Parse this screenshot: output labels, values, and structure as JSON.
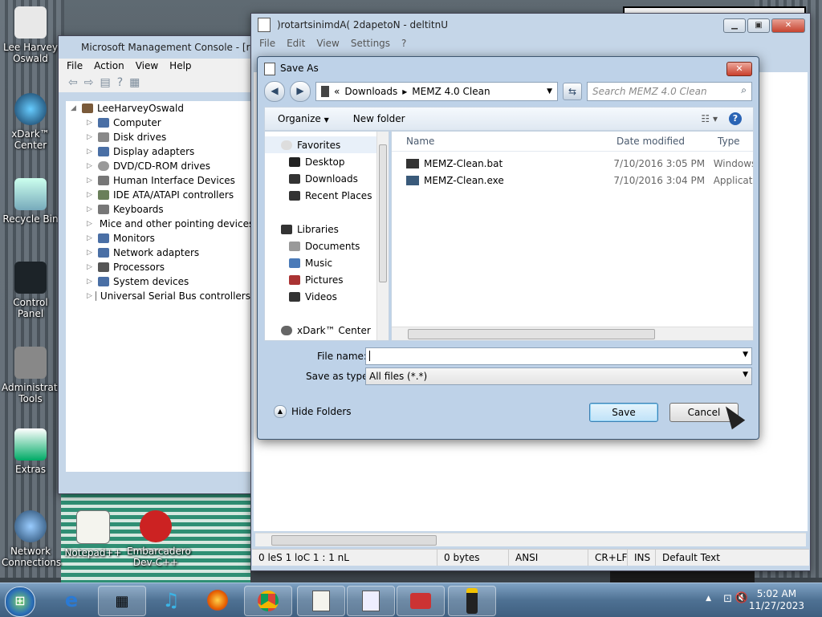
{
  "desktop": {
    "icons": [
      {
        "label": "Lee Harvey Oswald",
        "icon": "user-folder-icon"
      },
      {
        "label": "xDark™ Center",
        "icon": "xdark-center-icon"
      },
      {
        "label": "Recycle Bin",
        "icon": "recycle-bin-icon"
      },
      {
        "label": "Control Panel",
        "icon": "control-panel-icon"
      },
      {
        "label": "Administrat... Tools",
        "icon": "admin-tools-icon"
      },
      {
        "label": "Extras",
        "icon": "extras-icon"
      },
      {
        "label": "Network Connections",
        "icon": "network-icon"
      },
      {
        "label": "Notepad++",
        "icon": "notepad-plus-icon"
      },
      {
        "label": "Embarcadero Dev-C++",
        "icon": "devcpp-icon"
      }
    ]
  },
  "mmc": {
    "title": "Microsoft Management Console - [retup",
    "menu": [
      "File",
      "Action",
      "View",
      "Help"
    ],
    "root": "LeeHarveyOswald",
    "items": [
      "Computer",
      "Disk drives",
      "Display adapters",
      "DVD/CD-ROM drives",
      "Human Interface Devices",
      "IDE ATA/ATAPI controllers",
      "Keyboards",
      "Mice and other pointing devices",
      "Monitors",
      "Network adapters",
      "Processors",
      "System devices",
      "Universal Serial Bus controllers"
    ]
  },
  "notepad": {
    "title": ")rotartsinimdA( 2dapetoN - deltitnU",
    "menu": [
      "File",
      "Edit",
      "View",
      "Settings",
      "?"
    ],
    "status": {
      "position": "0 leS  1 loC  1 : 1 nL",
      "size": "0 bytes",
      "encoding": "ANSI",
      "eol": "CR+LF",
      "mode": "INS",
      "style": "Default Text"
    }
  },
  "dialog": {
    "title": "Save As",
    "breadcrumb": [
      "«",
      "Downloads",
      "MEMZ 4.0 Clean"
    ],
    "search_placeholder": "Search MEMZ 4.0 Clean",
    "toolbar": {
      "organize": "Organize",
      "new_folder": "New folder"
    },
    "nav": {
      "favorites_label": "Favorites",
      "favorites": [
        "Desktop",
        "Downloads",
        "Recent Places"
      ],
      "libraries_label": "Libraries",
      "libraries": [
        "Documents",
        "Music",
        "Pictures",
        "Videos"
      ],
      "other": "xDark™ Center"
    },
    "columns": {
      "name": "Name",
      "date": "Date modified",
      "type": "Type"
    },
    "files": [
      {
        "name": "MEMZ-Clean.bat",
        "date": "7/10/2016 3:05 PM",
        "type": "Windows"
      },
      {
        "name": "MEMZ-Clean.exe",
        "date": "7/10/2016 3:04 PM",
        "type": "Applicatio"
      }
    ],
    "file_name_label": "File name:",
    "file_name_value": "",
    "save_type_label": "Save as type:",
    "save_type_value": "All files (*.*)",
    "hide_folders": "Hide Folders",
    "save_button": "Save",
    "cancel_button": "Cancel"
  },
  "taskbar": {
    "apps": [
      "internet-explorer-icon",
      "archive-icon",
      "itunes-icon",
      "firefox-icon",
      "chrome-icon",
      "notepad-icon",
      "notepad-plus-icon",
      "toolbox-icon",
      "pos-terminal-icon"
    ],
    "time": "5:02 AM",
    "date": "11/27/2023"
  }
}
